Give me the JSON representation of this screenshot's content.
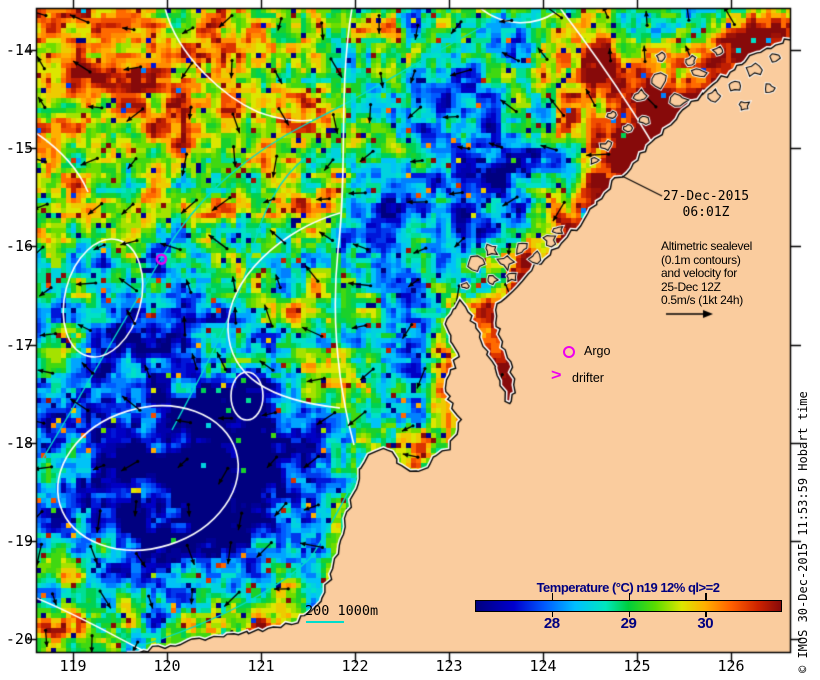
{
  "title_block": {
    "date_line1": "27-Dec-2015",
    "date_line2": "06:01Z"
  },
  "altimetric_note": {
    "lines": [
      "Altimetric sealevel",
      "(0.1m contours)",
      "and velocity for",
      "25-Dec 12Z",
      "0.5m/s (1kt 24h)"
    ]
  },
  "legend": {
    "argo_label": "Argo",
    "drifter_label": "drifter",
    "drifter_glyph": ">",
    "depth_label": "200 1000m"
  },
  "colorbar": {
    "title": "Temperature (°C) n19 12% ql>=2",
    "range": [
      27,
      31
    ],
    "tick_values": [
      28,
      29,
      30
    ],
    "gradient": [
      [
        27.0,
        "#000080"
      ],
      [
        27.5,
        "#0000cd"
      ],
      [
        27.9,
        "#005aff"
      ],
      [
        28.3,
        "#00beff"
      ],
      [
        28.7,
        "#00e6be"
      ],
      [
        29.0,
        "#00cd3c"
      ],
      [
        29.35,
        "#5adc00"
      ],
      [
        29.7,
        "#dce600"
      ],
      [
        30.0,
        "#ffaf00"
      ],
      [
        30.35,
        "#ff5f00"
      ],
      [
        30.7,
        "#cd2300"
      ],
      [
        31.0,
        "#870a0a"
      ]
    ]
  },
  "axes": {
    "x": {
      "ticks": [
        119,
        120,
        121,
        122,
        123,
        124,
        125,
        126
      ],
      "range": [
        118.606,
        126.638
      ]
    },
    "y": {
      "ticks": [
        -14,
        -15,
        -16,
        -17,
        -18,
        -19,
        -20
      ],
      "range": [
        -13.571,
        -20.143
      ]
    }
  },
  "markers": {
    "argo_map": {
      "lon": 119.94,
      "lat": -16.13
    }
  },
  "copyright": "© IMOS 30-Dec-2015 11:53:59 Hobart time",
  "colors": {
    "land": "#facc9e",
    "magenta": "#ee00ee",
    "bathy_cyan": "#00ddcc",
    "contour_white": "#ffffff",
    "navy": "#000080",
    "black": "#000000"
  },
  "chart_data": {
    "type": "heatmap",
    "title": "Temperature (°C) n19 12% ql>=2",
    "x_axis": {
      "label": "longitude_deg_E",
      "ticks": [
        119,
        120,
        121,
        122,
        123,
        124,
        125,
        126
      ],
      "range": [
        118.61,
        126.64
      ]
    },
    "y_axis": {
      "label": "latitude_deg",
      "ticks": [
        -14,
        -15,
        -16,
        -17,
        -18,
        -19,
        -20
      ],
      "range": [
        -20.14,
        -13.57
      ]
    },
    "colorbar": {
      "units": "°C",
      "range": [
        27,
        31
      ],
      "ticks": [
        28,
        29,
        30
      ]
    },
    "annotations": [
      "27-Dec-2015 06:01Z",
      "Altimetric sealevel (0.1m contours) and velocity for 25-Dec 12Z 0.5m/s (1kt 24h)",
      "200 1000m",
      "Argo",
      "drifter"
    ],
    "markers": [
      {
        "name": "argo-float",
        "lon": 119.94,
        "lat": -16.13
      }
    ]
  }
}
